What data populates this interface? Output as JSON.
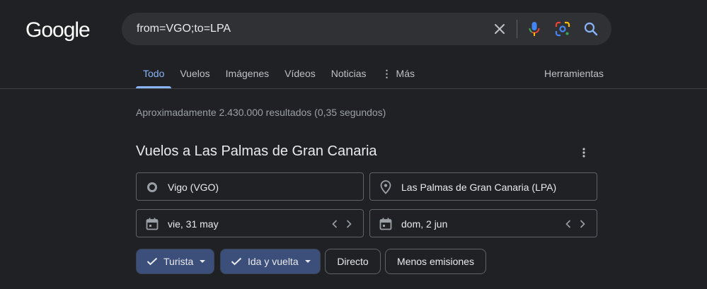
{
  "logo": "Google",
  "search": {
    "query": "from=VGO;to=LPA"
  },
  "tabs": [
    {
      "label": "Todo",
      "active": true
    },
    {
      "label": "Vuelos"
    },
    {
      "label": "Imágenes"
    },
    {
      "label": "Vídeos"
    },
    {
      "label": "Noticias"
    },
    {
      "label": "Más"
    }
  ],
  "tools_label": "Herramientas",
  "results_stats": "Aproximadamente 2.430.000 resultados (0,35 segundos)",
  "flights": {
    "title": "Vuelos a Las Palmas de Gran Canaria",
    "origin": "Vigo (VGO)",
    "destination": "Las Palmas de Gran Canaria (LPA)",
    "depart_date": "vie, 31 may",
    "return_date": "dom, 2 jun",
    "chips": {
      "cabin": "Turista",
      "trip_type": "Ida y vuelta",
      "nonstop": "Directo",
      "emissions": "Menos emisiones"
    }
  },
  "colors": {
    "background": "#202124",
    "accent": "#8ab4f8",
    "chip_selected": "#3b4f7a"
  }
}
